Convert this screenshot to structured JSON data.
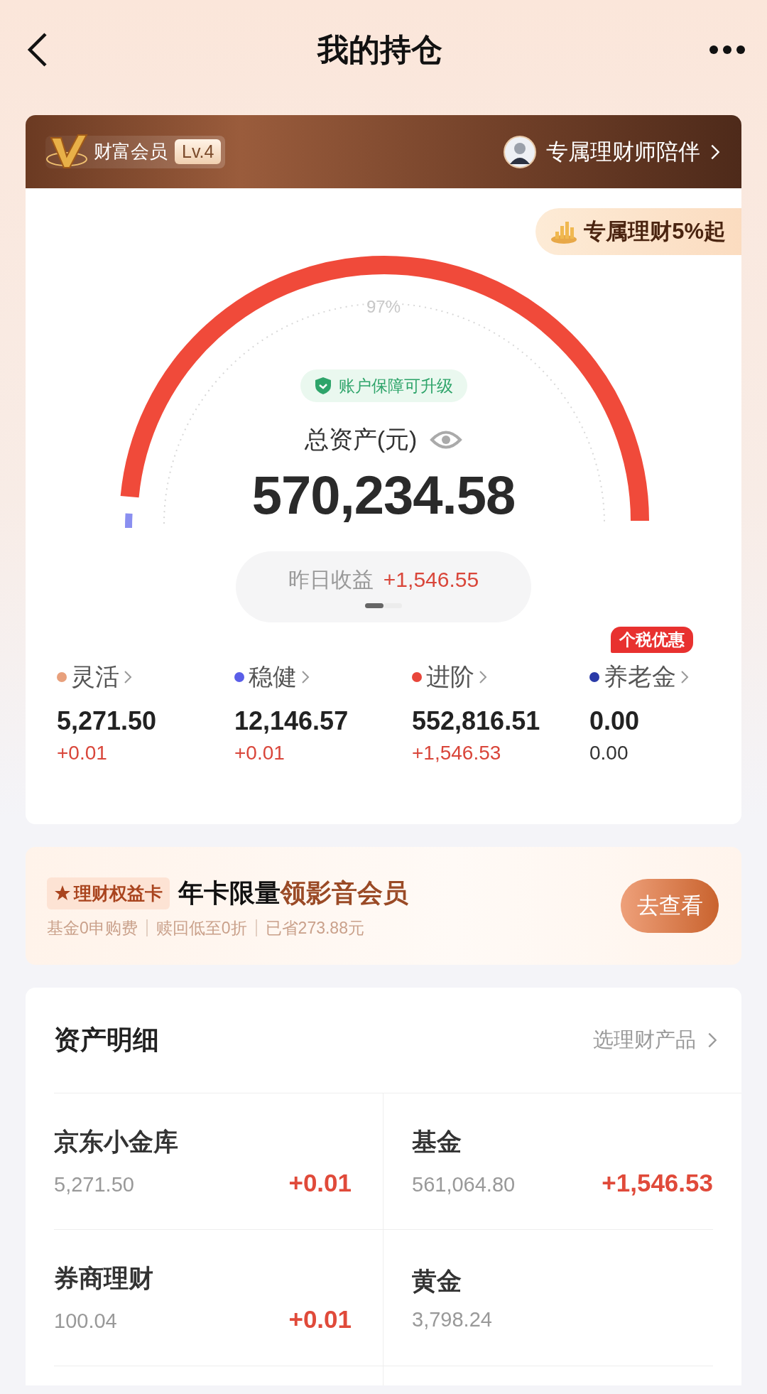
{
  "header": {
    "title": "我的持仓"
  },
  "member": {
    "name": "财富会员",
    "level_badge": "Lv.4",
    "advisor": "专属理财师陪伴"
  },
  "promo_tag": "专属理财5%起",
  "gauge": {
    "percent": "97%"
  },
  "protection": "账户保障可升级",
  "total": {
    "label": "总资产(元)",
    "value": "570,234.58"
  },
  "yesterday": {
    "label": "昨日收益",
    "value": "+1,546.55"
  },
  "pager": [
    {
      "selected": true
    },
    {
      "selected": false
    }
  ],
  "categories": [
    {
      "name": "灵活",
      "color": "#e8a07c",
      "amount": "5,271.50",
      "change": "+0.01",
      "positive": true
    },
    {
      "name": "稳健",
      "color": "#5a5ee8",
      "amount": "12,146.57",
      "change": "+0.01",
      "positive": true
    },
    {
      "name": "进阶",
      "color": "#e8463a",
      "amount": "552,816.51",
      "change": "+1,546.53",
      "positive": true
    },
    {
      "name": "养老金",
      "color": "#2a3aa8",
      "amount": "0.00",
      "change": "0.00",
      "positive": false,
      "badge": "个税优惠"
    }
  ],
  "benefit": {
    "tag": "理财权益卡",
    "title": "年卡限量",
    "title_highlight": "领影音会员",
    "perks": [
      "基金0申购费",
      "赎回低至0折",
      "已省273.88元"
    ],
    "button": "去查看"
  },
  "details": {
    "title": "资产明细",
    "link": "选理财产品",
    "items": [
      {
        "name": "京东小金库",
        "amount": "5,271.50",
        "change": "+0.01"
      },
      {
        "name": "基金",
        "amount": "561,064.80",
        "change": "+1,546.53"
      },
      {
        "name": "券商理财",
        "amount": "100.04",
        "change": "+0.01"
      },
      {
        "name": "黄金",
        "amount": "3,798.24"
      }
    ]
  }
}
